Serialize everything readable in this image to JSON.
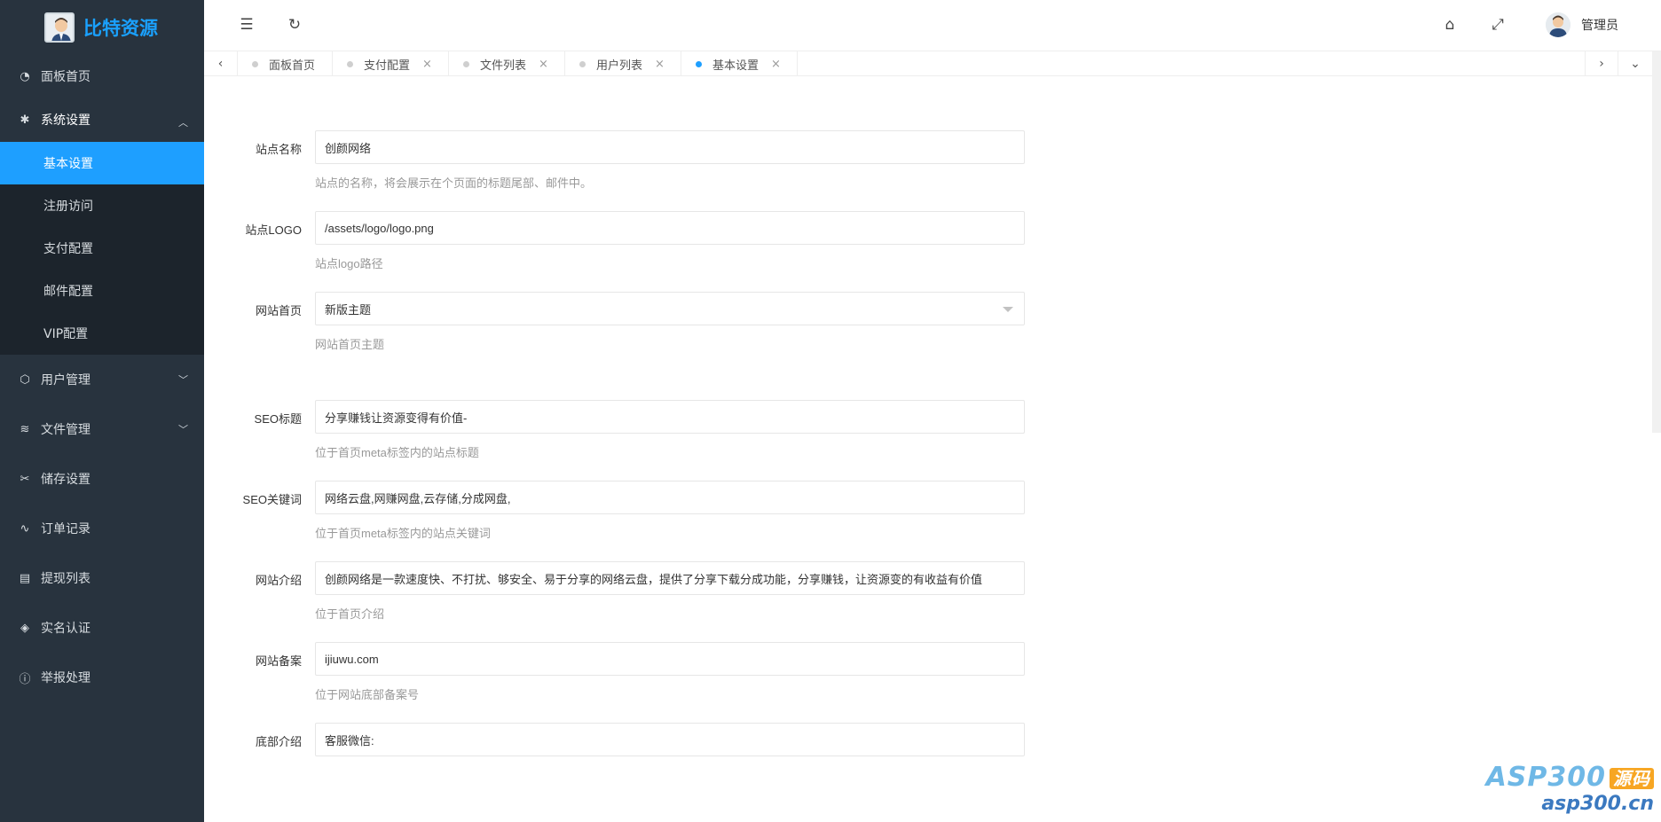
{
  "brand": {
    "title": "比特资源"
  },
  "sidebar": {
    "items": [
      {
        "label": "面板首页",
        "icon": "dashboard-icon",
        "glyph": "◔"
      },
      {
        "label": "系统设置",
        "icon": "gear-icon",
        "glyph": "✱",
        "chevron": "︿"
      },
      {
        "label": "用户管理",
        "icon": "cube-icon",
        "glyph": "⬡",
        "chevron": "﹀"
      },
      {
        "label": "文件管理",
        "icon": "layers-icon",
        "glyph": "≋",
        "chevron": "﹀"
      },
      {
        "label": "储存设置",
        "icon": "storage-icon",
        "glyph": "✂"
      },
      {
        "label": "订单记录",
        "icon": "pulse-icon",
        "glyph": "∿"
      },
      {
        "label": "提现列表",
        "icon": "list-icon",
        "glyph": "▤"
      },
      {
        "label": "实名认证",
        "icon": "shield-check-icon",
        "glyph": "◈"
      },
      {
        "label": "举报处理",
        "icon": "info-icon",
        "glyph": "ⓘ"
      }
    ],
    "submenu": [
      "基本设置",
      "注册访问",
      "支付配置",
      "邮件配置",
      "VIP配置"
    ]
  },
  "header": {
    "menu_toggle_glyph": "☰",
    "refresh_glyph": "↻",
    "home_glyph": "⌂",
    "fullscreen_glyph": "⤢",
    "user": "管理员"
  },
  "tabs": {
    "left_arrow": "‹",
    "right_arrow": "›",
    "more_arrow": "⌄",
    "items": [
      {
        "label": "面板首页"
      },
      {
        "label": "支付配置",
        "close": "×"
      },
      {
        "label": "文件列表",
        "close": "×"
      },
      {
        "label": "用户列表",
        "close": "×"
      },
      {
        "label": "基本设置",
        "close": "×"
      }
    ]
  },
  "form": {
    "fields": [
      {
        "label": "站点名称",
        "value": "创颜网络",
        "help": "站点的名称，将会展示在个页面的标题尾部、邮件中。"
      },
      {
        "label": "站点LOGO",
        "value": "/assets/logo/logo.png",
        "help": "站点logo路径"
      },
      {
        "label": "网站首页",
        "value": "新版主题",
        "help": "网站首页主题"
      },
      {
        "label": "SEO标题",
        "value": "分享赚钱让资源变得有价值-",
        "help": "位于首页meta标签内的站点标题"
      },
      {
        "label": "SEO关键词",
        "value": "网络云盘,网赚网盘,云存储,分成网盘,",
        "help": "位于首页meta标签内的站点关键词"
      },
      {
        "label": "网站介绍",
        "value": "创颜网络是一款速度快、不打扰、够安全、易于分享的网络云盘，提供了分享下载分成功能，分享赚钱，让资源变的有收益有价值",
        "help": "位于首页介绍"
      },
      {
        "label": "网站备案",
        "value": "ijiuwu.com",
        "help": "位于网站底部备案号"
      },
      {
        "label": "底部介绍",
        "value": "客服微信:"
      }
    ]
  },
  "watermark": {
    "line1": "ASP300",
    "badge": "源码",
    "line2": "asp300.cn"
  },
  "colors": {
    "sidebar": "#28333e",
    "accent": "#1e9fff",
    "brand": "#1aa1ff"
  }
}
